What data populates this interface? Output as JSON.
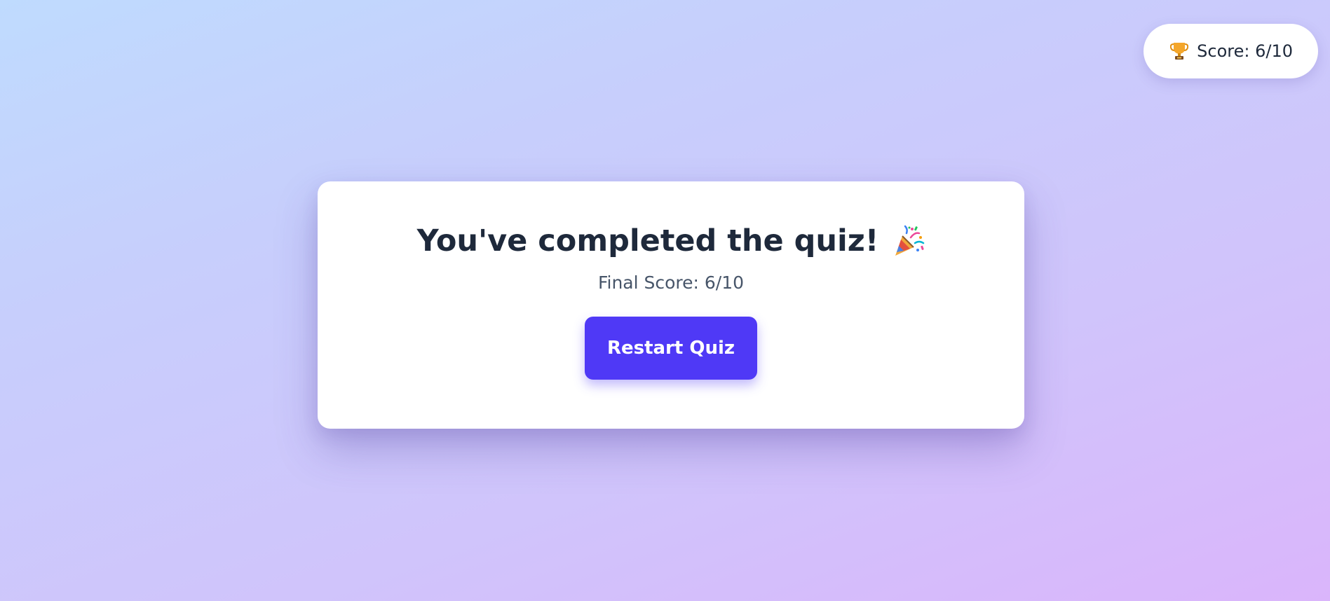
{
  "score_badge": {
    "icon": "trophy-icon",
    "label": "Score: 6/10"
  },
  "result_card": {
    "title": "You've completed the quiz!",
    "title_icon": "party-popper-icon",
    "final_score": "Final Score: 6/10",
    "restart_label": "Restart Quiz"
  },
  "colors": {
    "accent": "#4f39f6",
    "text_primary": "#1e293b",
    "text_secondary": "#475569",
    "background_start": "#bfdbfe",
    "background_end": "#dab5fb"
  }
}
